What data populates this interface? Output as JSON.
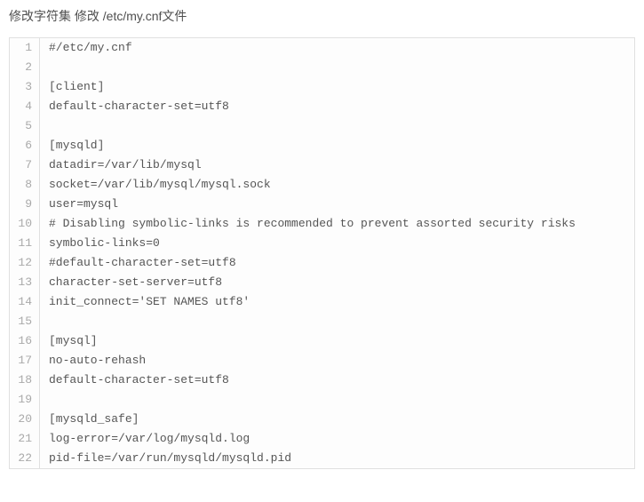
{
  "heading": "修改字符集 修改 /etc/my.cnf文件",
  "code": {
    "lines": [
      "#/etc/my.cnf",
      "",
      "[client]",
      "default-character-set=utf8",
      "",
      "[mysqld]",
      "datadir=/var/lib/mysql",
      "socket=/var/lib/mysql/mysql.sock",
      "user=mysql",
      "# Disabling symbolic-links is recommended to prevent assorted security risks",
      "symbolic-links=0",
      "#default-character-set=utf8",
      "character-set-server=utf8",
      "init_connect='SET NAMES utf8'",
      "",
      "[mysql]",
      "no-auto-rehash",
      "default-character-set=utf8",
      "",
      "[mysqld_safe]",
      "log-error=/var/log/mysqld.log",
      "pid-file=/var/run/mysqld/mysqld.pid"
    ]
  }
}
